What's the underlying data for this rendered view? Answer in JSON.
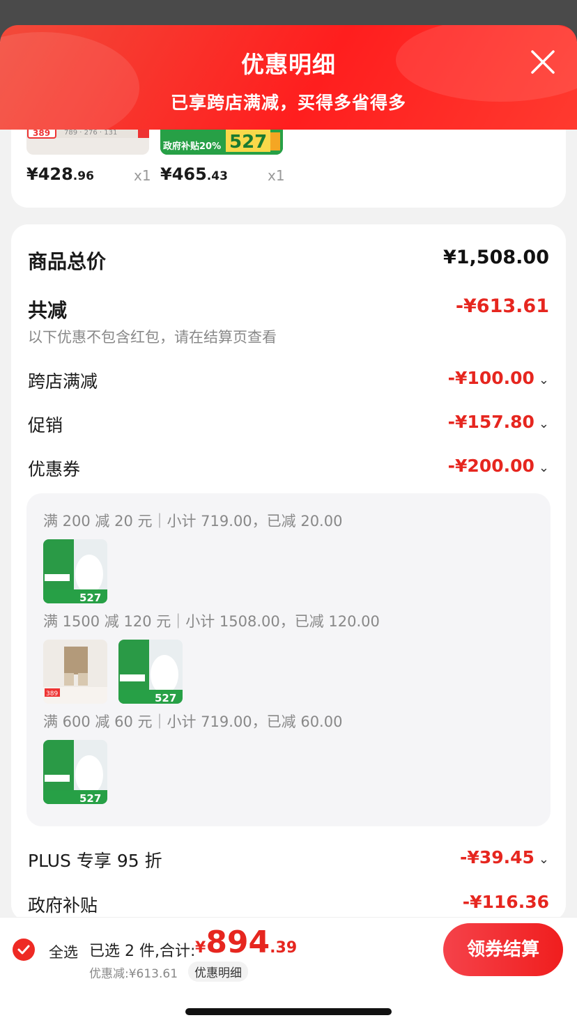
{
  "header": {
    "title": "优惠明细",
    "subtitle": "已享跨店满减，买得多省得多"
  },
  "top_items": [
    {
      "price_int": "¥428",
      "price_dec": ".96",
      "qty": "x1"
    },
    {
      "price_int": "¥465",
      "price_dec": ".43",
      "qty": "x1"
    }
  ],
  "summary": {
    "total_label": "商品总价",
    "total_value": "¥1,508.00",
    "reduce_label": "共减",
    "reduce_value": "-¥613.61",
    "note": "以下优惠不包含红包，请在结算页查看",
    "lines": [
      {
        "label": "跨店满减",
        "value": "-¥100.00"
      },
      {
        "label": "促销",
        "value": "-¥157.80"
      },
      {
        "label": "优惠券",
        "value": "-¥200.00"
      },
      {
        "label": "PLUS 专享 95 折",
        "value": "-¥39.45"
      },
      {
        "label": "政府补贴",
        "value": "-¥116.36"
      }
    ]
  },
  "coupons": [
    {
      "text": "满 200 减 20 元｜小计 719.00，已减 20.00"
    },
    {
      "text": "满 1500 减 120 元｜小计 1508.00，已减 120.00"
    },
    {
      "text": "满 600 减 60 元｜小计 719.00，已减 60.00"
    }
  ],
  "thumb_texts": {
    "toilet_price": "527",
    "toilet_subsidy": "政府补贴20%",
    "pants_price": "389"
  },
  "bottom": {
    "select_all": "全选",
    "summary_text": "已选 2 件,合计:",
    "currency": "¥",
    "price_int": "894",
    "price_dec": ".39",
    "discount_text": "优惠减:¥613.61",
    "detail_pill": "优惠明细",
    "checkout": "领券结算"
  },
  "colors": {
    "accent": "#e6261f",
    "header": "#ff1e1e"
  }
}
